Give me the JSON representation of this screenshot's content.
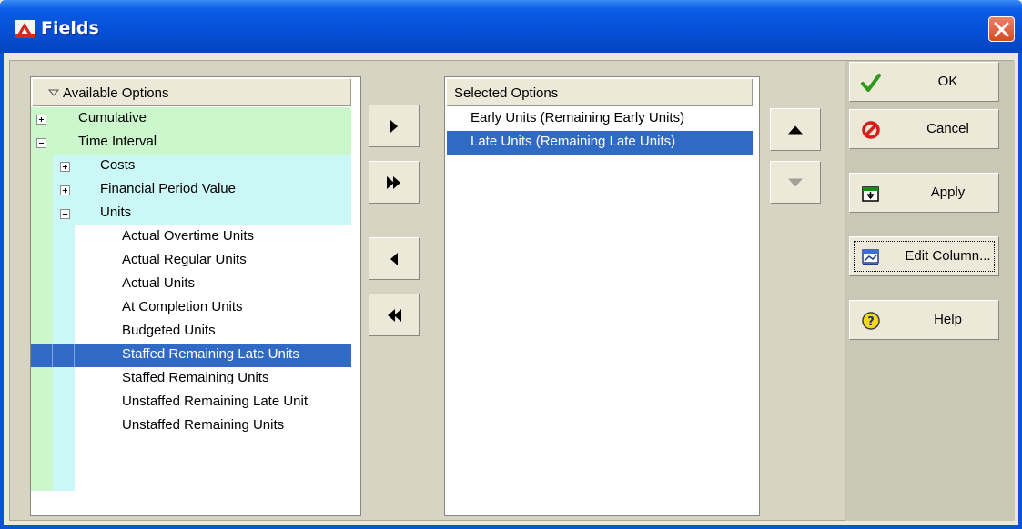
{
  "window": {
    "title": "Fields"
  },
  "available": {
    "header": "Available Options",
    "items": [
      {
        "label": "Cumulative"
      },
      {
        "label": "Time Interval"
      },
      {
        "label": "Costs"
      },
      {
        "label": "Financial Period Value"
      },
      {
        "label": "Units"
      },
      {
        "label": "Actual Overtime Units"
      },
      {
        "label": "Actual Regular Units"
      },
      {
        "label": "Actual Units"
      },
      {
        "label": "At Completion Units"
      },
      {
        "label": "Budgeted Units"
      },
      {
        "label": "Staffed Remaining Late Units"
      },
      {
        "label": "Staffed Remaining Units"
      },
      {
        "label": "Unstaffed Remaining Late Unit"
      },
      {
        "label": "Unstaffed Remaining Units"
      }
    ]
  },
  "selected": {
    "header": "Selected Options",
    "items": [
      {
        "label": "Early Units  (Remaining Early Units)"
      },
      {
        "label": "Late Units  (Remaining Late Units)"
      }
    ]
  },
  "buttons": {
    "ok": "OK",
    "cancel": "Cancel",
    "apply": "Apply",
    "edit_column": "Edit Column...",
    "help": "Help"
  },
  "colors": {
    "selection": "#316ac5",
    "tree_green": "#ccf7cc",
    "tree_cyan": "#ccf7f7",
    "titlebar": "#0650d8"
  }
}
